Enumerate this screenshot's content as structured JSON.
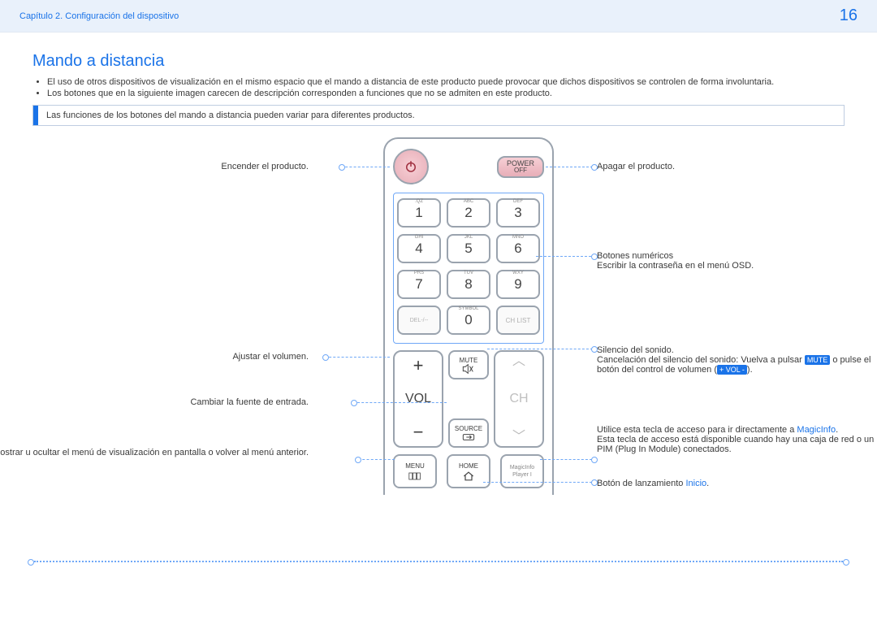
{
  "header": {
    "breadcrumb": "Capítulo 2. Configuración del dispositivo",
    "page": "16"
  },
  "title": "Mando a distancia",
  "bullets": [
    "El uso de otros dispositivos de visualización en el mismo espacio que el mando a distancia de este producto puede provocar que dichos dispositivos se controlen de forma involuntaria.",
    "Los botones que en la siguiente imagen carecen de descripción corresponden a funciones que no se admiten en este producto."
  ],
  "note": "Las funciones de los botones del mando a distancia pueden variar para diferentes productos.",
  "remote": {
    "power_off": {
      "line1": "POWER",
      "line2": "OFF"
    },
    "numpad": {
      "subs": [
        ".QZ",
        "ABC",
        "DEF",
        "GHI",
        "JKL",
        "MNO",
        "PRS",
        "TUV",
        "WXY",
        "DEL-/--",
        "SYMBOL"
      ],
      "nums": [
        "1",
        "2",
        "3",
        "4",
        "5",
        "6",
        "7",
        "8",
        "9",
        "0"
      ],
      "chlist": "CH LIST"
    },
    "vol": "VOL",
    "ch": "CH",
    "mute": "MUTE",
    "source": "SOURCE",
    "menu": "MENU",
    "home": "HOME",
    "magic": {
      "line1": "MagicInfo",
      "line2": "Player I"
    }
  },
  "labels": {
    "left": {
      "power_on": "Encender el producto.",
      "volume": "Ajustar el volumen.",
      "source": "Cambiar la fuente de entrada.",
      "menu": "Mostrar u ocultar el menú de visualización en pantalla o volver al menú anterior."
    },
    "right": {
      "power_off": "Apagar el producto.",
      "numbers_title": "Botones numéricos",
      "numbers_desc": "Escribir la contraseña en el menú OSD.",
      "mute_title": "Silencio del sonido.",
      "mute_desc_a": "Cancelación del silencio del sonido: Vuelva a pulsar ",
      "mute_tag": "MUTE",
      "mute_desc_b": " o pulse el botón del control de volumen (",
      "vol_tag": "+ VOL -",
      "mute_desc_c": ").",
      "magic_a": "Utilice esta tecla de acceso para ir directamente a ",
      "magic_link": "MagicInfo",
      "magic_b": ".",
      "magic_desc": "Esta tecla de acceso está disponible cuando hay una caja de red o un PIM (Plug In Module) conectados.",
      "home_a": "Botón de lanzamiento ",
      "home_link": "Inicio",
      "home_b": "."
    }
  }
}
